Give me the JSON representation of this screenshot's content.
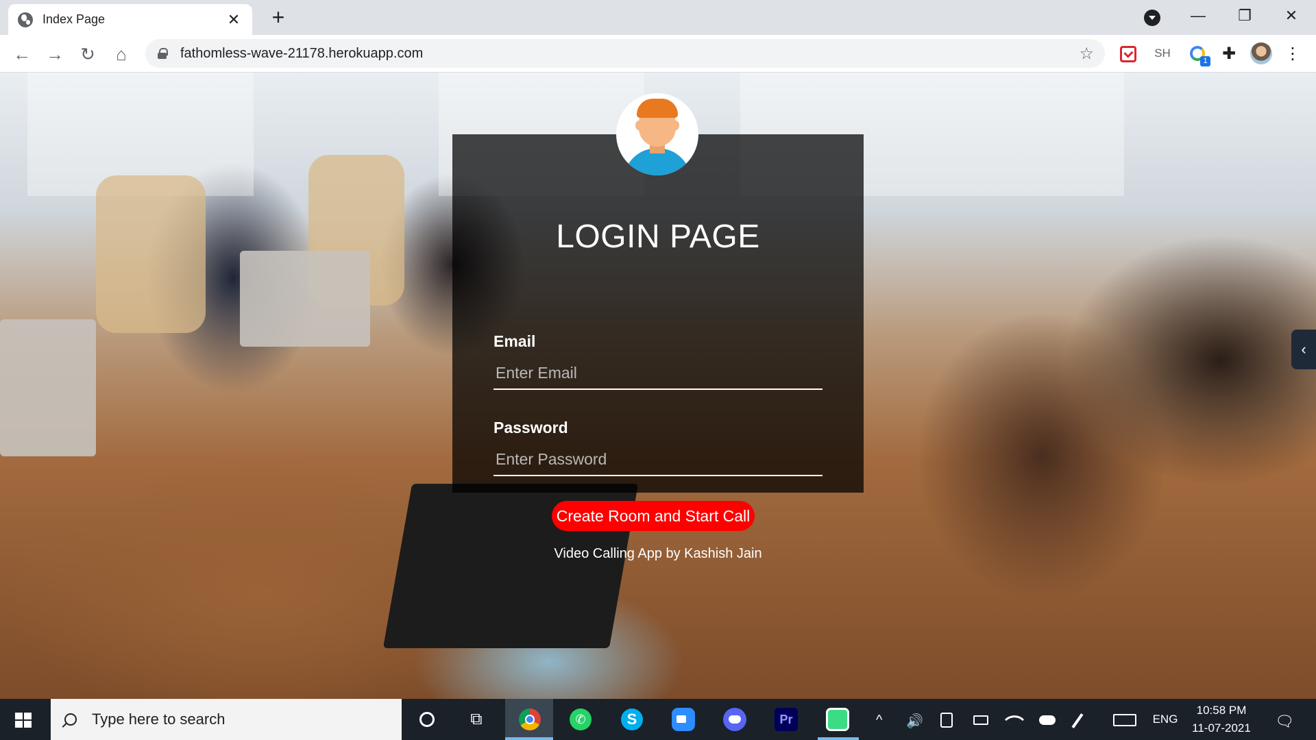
{
  "browser": {
    "tab_title": "Index Page",
    "close_tab": "✕",
    "new_tab": "+",
    "url": "fathomless-wave-21178.herokuapp.com",
    "nav": {
      "back": "←",
      "forward": "→",
      "reload": "↻",
      "home": "⌂"
    },
    "star": "☆",
    "extensions": {
      "sh_label": "SH",
      "badge_count": "1",
      "puzzle": "✚",
      "menu": "⋮"
    },
    "window": {
      "minimize": "—",
      "restore": "❐",
      "close": "✕"
    }
  },
  "login": {
    "title": "LOGIN PAGE",
    "email_label": "Email",
    "email_placeholder": "Enter Email",
    "password_label": "Password",
    "password_placeholder": "Enter Password",
    "submit_label": "Create Room and Start Call",
    "credit": "Video Calling App by Kashish Jain",
    "side_tab": "‹"
  },
  "taskbar": {
    "search_placeholder": "Type here to search",
    "task_view": "⧉",
    "whatsapp_glyph": "✆",
    "skype_glyph": "S",
    "premiere_glyph": "Pr",
    "tray": {
      "chevron": "^",
      "volume": "🔊",
      "language": "ENG",
      "time": "10:58 PM",
      "date": "11-07-2021",
      "notifications": "🗨"
    }
  },
  "colors": {
    "accent_button": "#ff0000",
    "card_bg": "rgba(0,0,0,0.72)",
    "taskbar_bg": "#1a2129"
  }
}
